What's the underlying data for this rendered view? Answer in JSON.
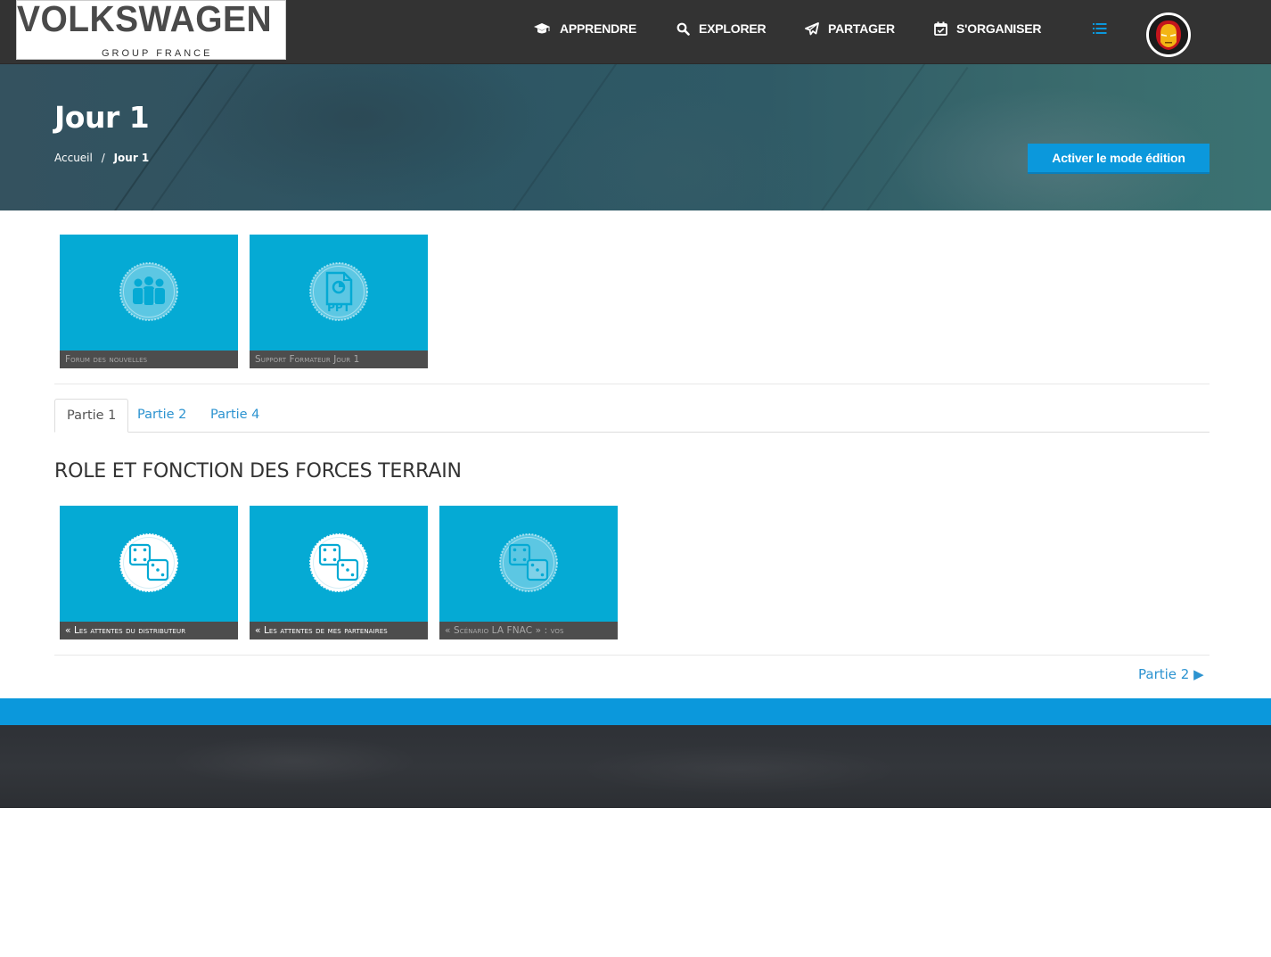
{
  "brand": {
    "name": "VOLKSWAGEN",
    "subtitle": "GROUP FRANCE"
  },
  "nav": {
    "items": [
      {
        "label": "APPRENDRE",
        "icon": "graduation-cap-icon"
      },
      {
        "label": "EXPLORER",
        "icon": "search-icon"
      },
      {
        "label": "PARTAGER",
        "icon": "paper-plane-icon"
      },
      {
        "label": "S'ORGANISER",
        "icon": "calendar-check-icon"
      }
    ],
    "menu_icon": "list-icon",
    "avatar_icon": "iron-man-avatar-icon"
  },
  "hero": {
    "title": "Jour 1",
    "breadcrumb": {
      "home": "Accueil",
      "separator": "/",
      "current": "Jour 1"
    },
    "edit_button": "Activer le mode édition"
  },
  "top_tiles": [
    {
      "caption": "Forum des nouvelles",
      "icon": "group-icon"
    },
    {
      "caption": "Support Formateur Jour 1",
      "icon": "ppt-file-icon"
    }
  ],
  "tabs": [
    {
      "label": "Partie 1",
      "active": true
    },
    {
      "label": "Partie 2",
      "active": false
    },
    {
      "label": "Partie 4",
      "active": false
    }
  ],
  "section": {
    "title": "ROLE ET FONCTION DES FORCES TERRAIN",
    "tiles": [
      {
        "caption": "« Les attentes du distributeur",
        "icon": "dice-icon"
      },
      {
        "caption": "« Les attentes de mes partenaires",
        "icon": "dice-icon"
      },
      {
        "caption": "« Scénario LA FNAC » : vos",
        "icon": "dice-icon"
      }
    ],
    "next_link": "Partie 2 ▶"
  },
  "colors": {
    "navbar": "#333333",
    "accent": "#0b98dc",
    "tile": "#05aad4",
    "link": "#2c93d0",
    "footer": "#2f3237"
  }
}
